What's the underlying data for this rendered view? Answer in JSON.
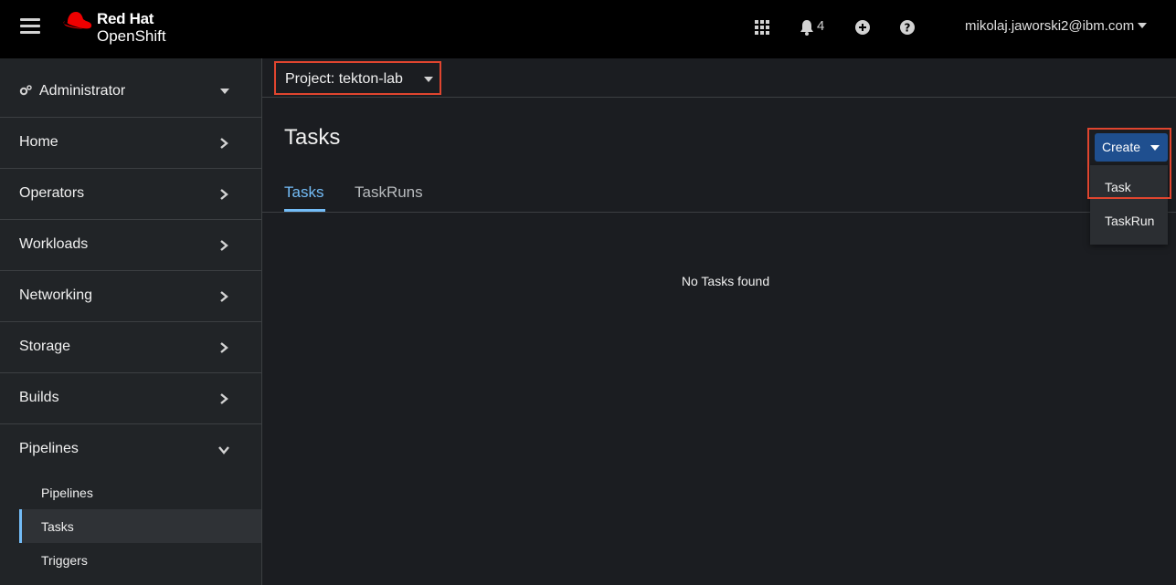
{
  "masthead": {
    "brand_line1": "Red Hat",
    "brand_line2": "OpenShift",
    "notification_count": "4",
    "user": "mikolaj.jaworski2@ibm.com",
    "icons": [
      "menu-icon",
      "apps-grid-icon",
      "bell-icon",
      "plus-circle-icon",
      "help-icon"
    ]
  },
  "sidebar": {
    "perspective": "Administrator",
    "items": [
      {
        "label": "Home"
      },
      {
        "label": "Operators"
      },
      {
        "label": "Workloads"
      },
      {
        "label": "Networking"
      },
      {
        "label": "Storage"
      },
      {
        "label": "Builds"
      },
      {
        "label": "Pipelines",
        "expanded": true
      }
    ],
    "pipelines_sub": [
      {
        "label": "Pipelines"
      },
      {
        "label": "Tasks",
        "active": true
      },
      {
        "label": "Triggers"
      }
    ]
  },
  "project": {
    "label": "Project: tekton-lab"
  },
  "page": {
    "title": "Tasks",
    "tabs": [
      {
        "label": "Tasks",
        "active": true
      },
      {
        "label": "TaskRuns"
      }
    ],
    "empty_message": "No Tasks found"
  },
  "create": {
    "label": "Create",
    "menu": [
      "Task",
      "TaskRun"
    ]
  },
  "colors": {
    "accent": "#73bcf7",
    "highlight": "#e0452f",
    "primary_button": "#1f4f8f",
    "brand_red": "#ee0000"
  }
}
